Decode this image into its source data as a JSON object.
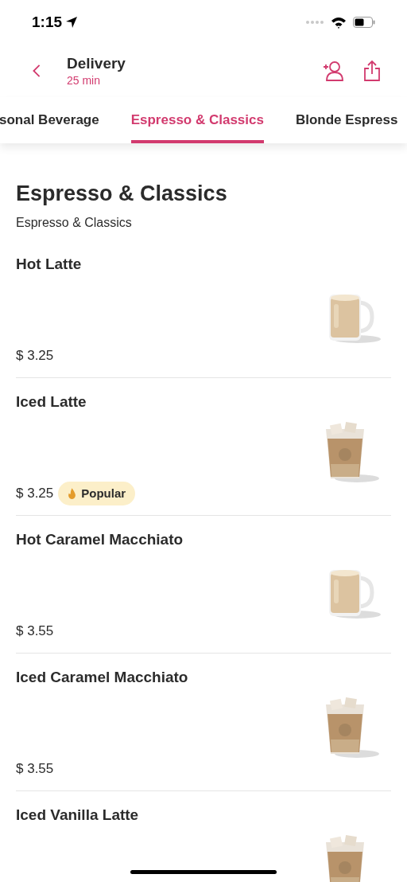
{
  "status_bar": {
    "time": "1:15"
  },
  "header": {
    "title": "Delivery",
    "subtitle": "25 min"
  },
  "tabs": [
    {
      "label": "sonal Beverage",
      "selected": false
    },
    {
      "label": "Espresso & Classics",
      "selected": true
    },
    {
      "label": "Blonde Espress",
      "selected": false
    }
  ],
  "section": {
    "title": "Espresso & Classics",
    "subtitle": "Espresso & Classics"
  },
  "items": [
    {
      "name": "Hot Latte",
      "price": "$ 3.25",
      "kind": "hot"
    },
    {
      "name": "Iced Latte",
      "price": "$ 3.25",
      "badge": "Popular",
      "kind": "iced"
    },
    {
      "name": "Hot Caramel Macchiato",
      "price": "$ 3.55",
      "kind": "hot"
    },
    {
      "name": "Iced Caramel Macchiato",
      "price": "$ 3.55",
      "kind": "iced"
    },
    {
      "name": "Iced Vanilla Latte",
      "kind": "iced"
    }
  ]
}
